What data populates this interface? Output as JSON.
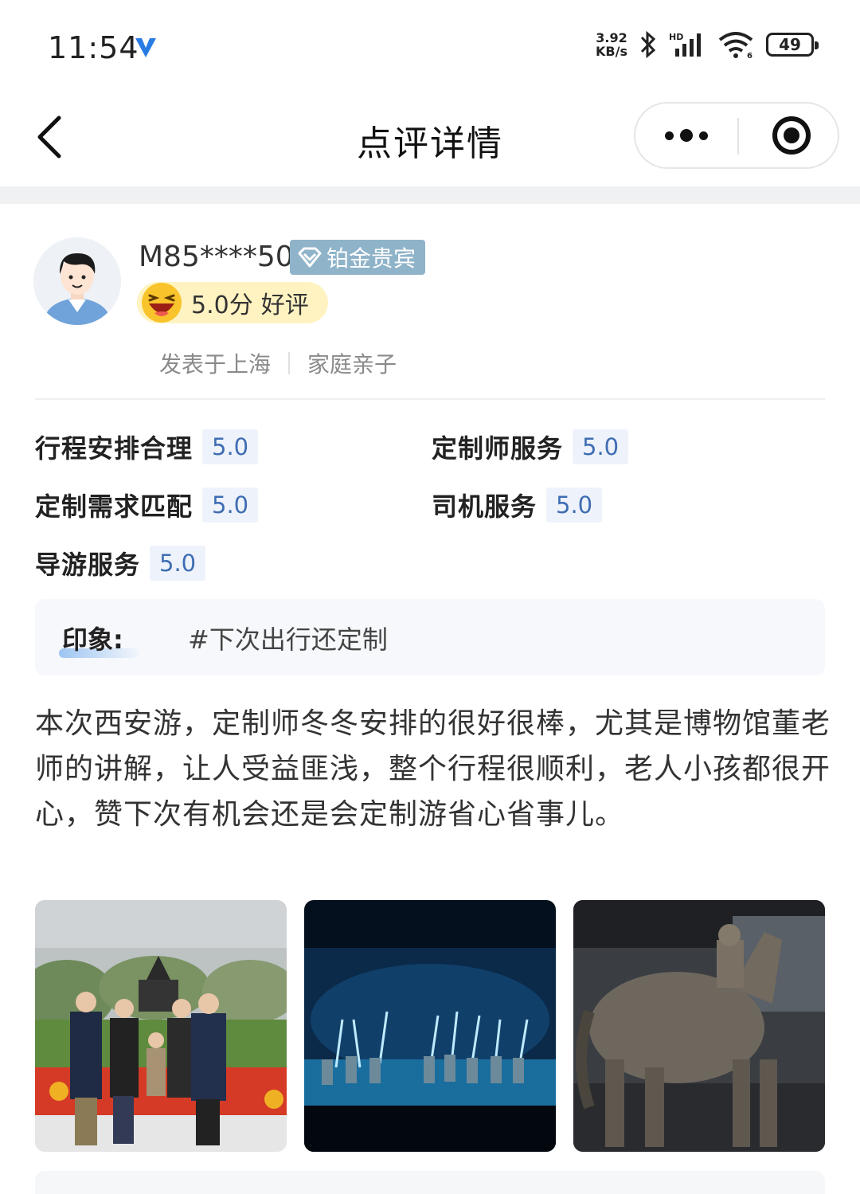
{
  "status_bar": {
    "time": "11:54",
    "net_speed_value": "3.92",
    "net_speed_unit": "KB/s",
    "battery": "49",
    "icons": [
      "vpn-v-icon",
      "bluetooth-icon",
      "hd-signal-icon",
      "wifi-icon",
      "battery-icon"
    ]
  },
  "nav": {
    "title": "点评详情",
    "icons": [
      "back-chevron-icon",
      "more-dots-icon",
      "close-target-icon"
    ]
  },
  "review": {
    "username": "M85****50",
    "vip_label": "铂金贵宾",
    "rating_score": "5.0分",
    "rating_label": "好评",
    "posted_from": "发表于上海",
    "trip_type": "家庭亲子",
    "scores": [
      {
        "label": "行程安排合理",
        "value": "5.0"
      },
      {
        "label": "定制师服务",
        "value": "5.0"
      },
      {
        "label": "定制需求匹配",
        "value": "5.0"
      },
      {
        "label": "司机服务",
        "value": "5.0"
      },
      {
        "label": "导游服务",
        "value": "5.0"
      }
    ],
    "impression_label": "印象:",
    "impression_tag": "#下次出行还定制",
    "text": "本次西安游，定制师冬冬安排的很好很棒，尤其是博物馆董老师的讲解，让人受益匪浅，整个行程很顺利，老人小孩都很开心，赞下次有机会还是会定制游省心省事儿。"
  },
  "colors": {
    "score_value": "#3f6db3",
    "vip_badge": "#8fb3c9",
    "rating_pill": "#fff3c2"
  }
}
